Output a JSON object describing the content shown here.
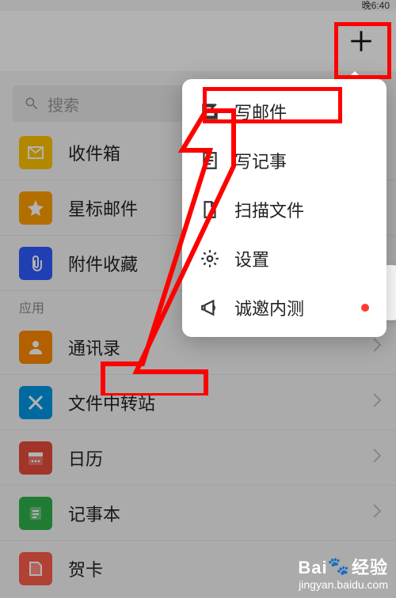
{
  "status": {
    "time": "晚6:40"
  },
  "search": {
    "placeholder": "搜索"
  },
  "sidebar": {
    "items": [
      {
        "label": "收件箱"
      },
      {
        "label": "星标邮件"
      },
      {
        "label": "附件收藏"
      }
    ]
  },
  "apps": {
    "section_label": "应用",
    "items": [
      {
        "label": "通讯录"
      },
      {
        "label": "文件中转站"
      },
      {
        "label": "日历"
      },
      {
        "label": "记事本"
      },
      {
        "label": "贺卡"
      }
    ]
  },
  "popup": {
    "items": [
      {
        "label": "写邮件"
      },
      {
        "label": "写记事"
      },
      {
        "label": "扫描文件"
      },
      {
        "label": "设置"
      },
      {
        "label": "诚邀内测"
      }
    ]
  },
  "watermark": {
    "brand": "Bai",
    "brand2": "经验",
    "url": "jingyan.baidu.com"
  }
}
